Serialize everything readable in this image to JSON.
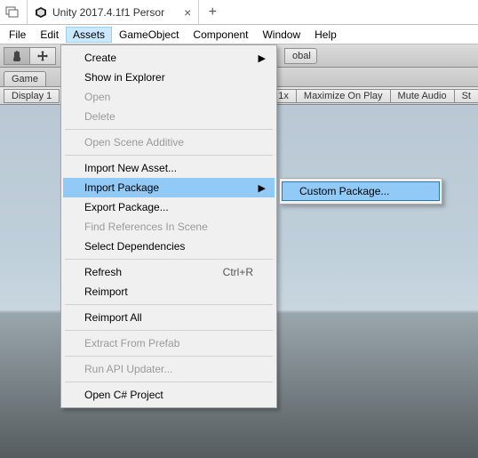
{
  "titlebar": {
    "app_tab_label": "Unity 2017.4.1f1 Persor"
  },
  "menubar": {
    "items": [
      "File",
      "Edit",
      "Assets",
      "GameObject",
      "Component",
      "Window",
      "Help"
    ],
    "active_index": 2
  },
  "toolbar": {
    "obal_label": "obal"
  },
  "subtabs": {
    "game": "Game"
  },
  "options": {
    "display": "Display 1",
    "scale_1x": "1x",
    "maximize": "Maximize On Play",
    "mute": "Mute Audio",
    "st": "St"
  },
  "assets_menu": {
    "create": "Create",
    "show_in_explorer": "Show in Explorer",
    "open": "Open",
    "delete": "Delete",
    "open_scene_additive": "Open Scene Additive",
    "import_new_asset": "Import New Asset...",
    "import_package": "Import Package",
    "export_package": "Export Package...",
    "find_references": "Find References In Scene",
    "select_dependencies": "Select Dependencies",
    "refresh": "Refresh",
    "refresh_shortcut": "Ctrl+R",
    "reimport": "Reimport",
    "reimport_all": "Reimport All",
    "extract_from_prefab": "Extract From Prefab",
    "run_api_updater": "Run API Updater...",
    "open_csharp": "Open C# Project"
  },
  "import_package_submenu": {
    "custom_package": "Custom Package..."
  }
}
